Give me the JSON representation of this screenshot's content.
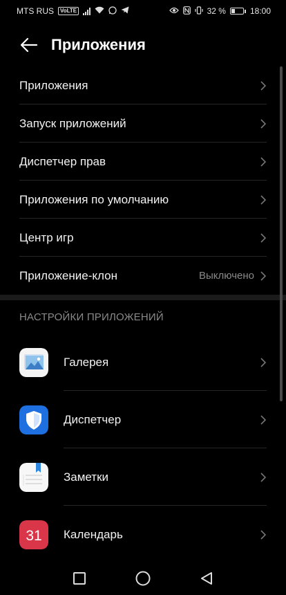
{
  "status_bar": {
    "carrier": "MTS RUS",
    "volte": "VoLTE",
    "battery_text": "32 %",
    "battery_level": 0.32,
    "time": "18:00"
  },
  "header": {
    "title": "Приложения"
  },
  "menu": [
    {
      "label": "Приложения",
      "value": ""
    },
    {
      "label": "Запуск приложений",
      "value": ""
    },
    {
      "label": "Диспетчер прав",
      "value": ""
    },
    {
      "label": "Приложения по умолчанию",
      "value": ""
    },
    {
      "label": "Центр игр",
      "value": ""
    },
    {
      "label": "Приложение-клон",
      "value": "Выключено"
    }
  ],
  "section_title": "НАСТРОЙКИ ПРИЛОЖЕНИЙ",
  "apps": [
    {
      "label": "Галерея",
      "icon": "gallery-icon"
    },
    {
      "label": "Диспетчер",
      "icon": "shield-icon"
    },
    {
      "label": "Заметки",
      "icon": "notes-icon"
    },
    {
      "label": "Календарь",
      "icon": "calendar-icon",
      "icon_text": "31"
    }
  ],
  "colors": {
    "background": "#000000",
    "text": "#f2f2f2",
    "secondary_text": "#8a8a8a",
    "calendar_red": "#d9364a",
    "shield_blue": "#1e6fe0"
  }
}
